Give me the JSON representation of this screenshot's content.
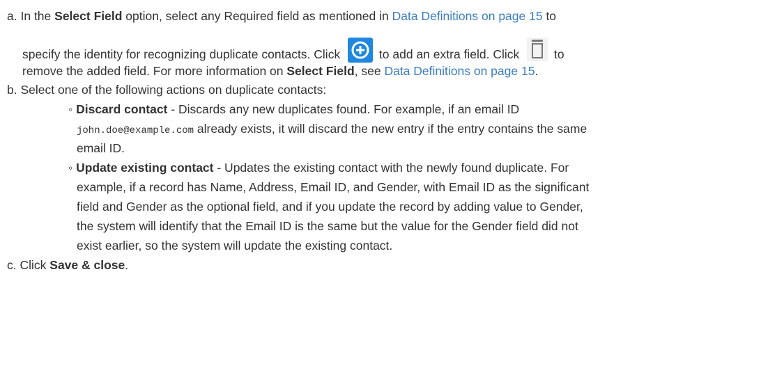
{
  "steps": {
    "a": {
      "marker": "a.",
      "t1": "In the ",
      "b1": "Select Field",
      "t2": " option, select any Required field as mentioned in ",
      "link1": "Data Definitions on page 15",
      "t3": " to",
      "t4": "specify the identity for recognizing duplicate contacts. Click ",
      "t5": " to add an extra field. Click ",
      "t6": " to",
      "t7": "remove the added field. For more information on ",
      "b2": "Select Field",
      "t8": ", see ",
      "link2": "Data Definitions on page 15",
      "t9": "."
    },
    "b": {
      "marker": "b.",
      "text": "Select one of the following actions on duplicate contacts:",
      "options": [
        {
          "bullet": "◦",
          "title": "Discard contact",
          "l1": " - Discards any new duplicates found. For example, if an email ID",
          "code": "john.doe@example.com",
          "l2": " already exists, it will discard the new entry if the entry contains the same",
          "l3": "email ID."
        },
        {
          "bullet": "◦",
          "title": "Update existing contact",
          "l1": " - Updates the existing contact with the newly found duplicate. For",
          "l2": "example, if a record has Name, Address, Email ID, and Gender, with Email ID as the significant",
          "l3": "field and Gender as the optional field, and if you update the record by adding value to Gender,",
          "l4": "the system will identify that the Email ID is the same but the value for the Gender field did not",
          "l5": "exist earlier, so the system will update the existing contact."
        }
      ]
    },
    "c": {
      "marker": "c.",
      "t1": "Click ",
      "b1": "Save & close",
      "t2": "."
    }
  },
  "icons": {
    "add": "plus-circle-icon",
    "remove": "trash-icon"
  },
  "colors": {
    "link": "#3b7dc4",
    "add_icon_bg": "#1f87e0",
    "text": "#333333"
  }
}
